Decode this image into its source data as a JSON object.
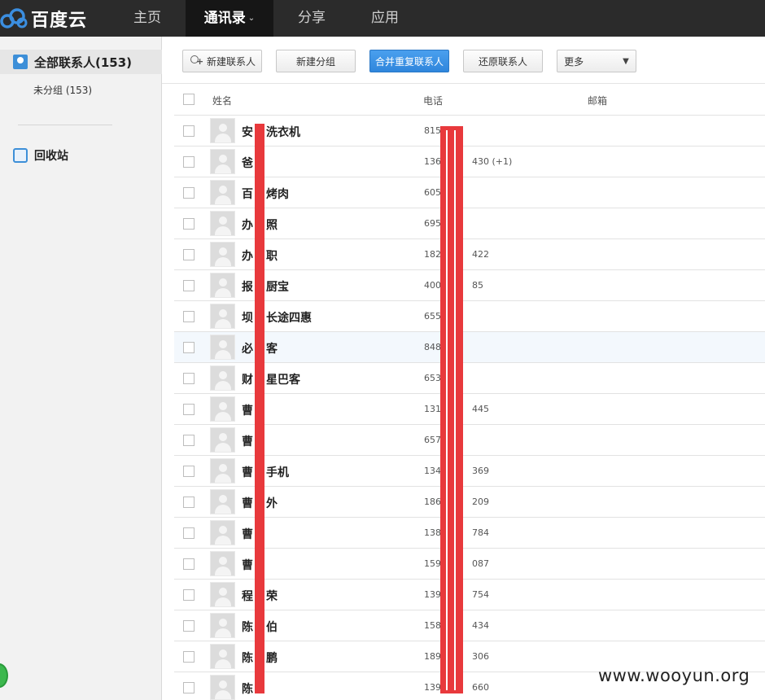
{
  "brand": {
    "name": "百度云"
  },
  "nav": {
    "items": [
      {
        "label": "主页"
      },
      {
        "label": "通讯录"
      },
      {
        "label": "分享"
      },
      {
        "label": "应用"
      }
    ],
    "active_index": 1
  },
  "sidebar": {
    "all_contacts": "全部联系人(153)",
    "ungrouped": "未分组 (153)",
    "recycle": "回收站"
  },
  "toolbar": {
    "new_contact": "新建联系人",
    "new_group": "新建分组",
    "merge": "合并重复联系人",
    "restore": "还原联系人",
    "more": "更多"
  },
  "table": {
    "headers": {
      "name": "姓名",
      "phone": "电话",
      "email": "邮箱"
    },
    "rows": [
      {
        "name": "安",
        "name_tail": "洗衣机",
        "phone": "815",
        "phone_tail": ""
      },
      {
        "name": "爸",
        "name_tail": "",
        "phone": "136",
        "phone_tail": "430 (+1)"
      },
      {
        "name": "百",
        "name_tail": "烤肉",
        "phone": "605",
        "phone_tail": ""
      },
      {
        "name": "办",
        "name_tail": "照",
        "phone": "695",
        "phone_tail": ""
      },
      {
        "name": "办",
        "name_tail": "职",
        "phone": "182",
        "phone_tail": "422"
      },
      {
        "name": "报",
        "name_tail": "厨宝",
        "phone": "400",
        "phone_tail": "85"
      },
      {
        "name": "坝",
        "name_tail": "长途四惠",
        "phone": "655",
        "phone_tail": ""
      },
      {
        "name": "必",
        "name_tail": "客",
        "phone": "848",
        "phone_tail": ""
      },
      {
        "name": "财",
        "name_tail": "星巴客",
        "phone": "653",
        "phone_tail": ""
      },
      {
        "name": "曹",
        "name_tail": "",
        "phone": "131",
        "phone_tail": "445"
      },
      {
        "name": "曹",
        "name_tail": "",
        "phone": "657",
        "phone_tail": ""
      },
      {
        "name": "曹",
        "name_tail": "手机",
        "phone": "134",
        "phone_tail": "369"
      },
      {
        "name": "曹",
        "name_tail": "外",
        "phone": "186",
        "phone_tail": "209"
      },
      {
        "name": "曹",
        "name_tail": "",
        "phone": "138",
        "phone_tail": "784"
      },
      {
        "name": "曹",
        "name_tail": "",
        "phone": "159",
        "phone_tail": "087"
      },
      {
        "name": "程",
        "name_tail": "荣",
        "phone": "139",
        "phone_tail": "754"
      },
      {
        "name": "陈",
        "name_tail": "伯",
        "phone": "158",
        "phone_tail": "434"
      },
      {
        "name": "陈",
        "name_tail": "鹏",
        "phone": "189",
        "phone_tail": "306"
      },
      {
        "name": "陈",
        "name_tail": "",
        "phone": "139",
        "phone_tail": "660"
      }
    ]
  },
  "watermark": "www.wooyun.org",
  "colors": {
    "topbar": "#2b2b2b",
    "accent": "#2f86dc",
    "redaction": "#e8393c"
  }
}
